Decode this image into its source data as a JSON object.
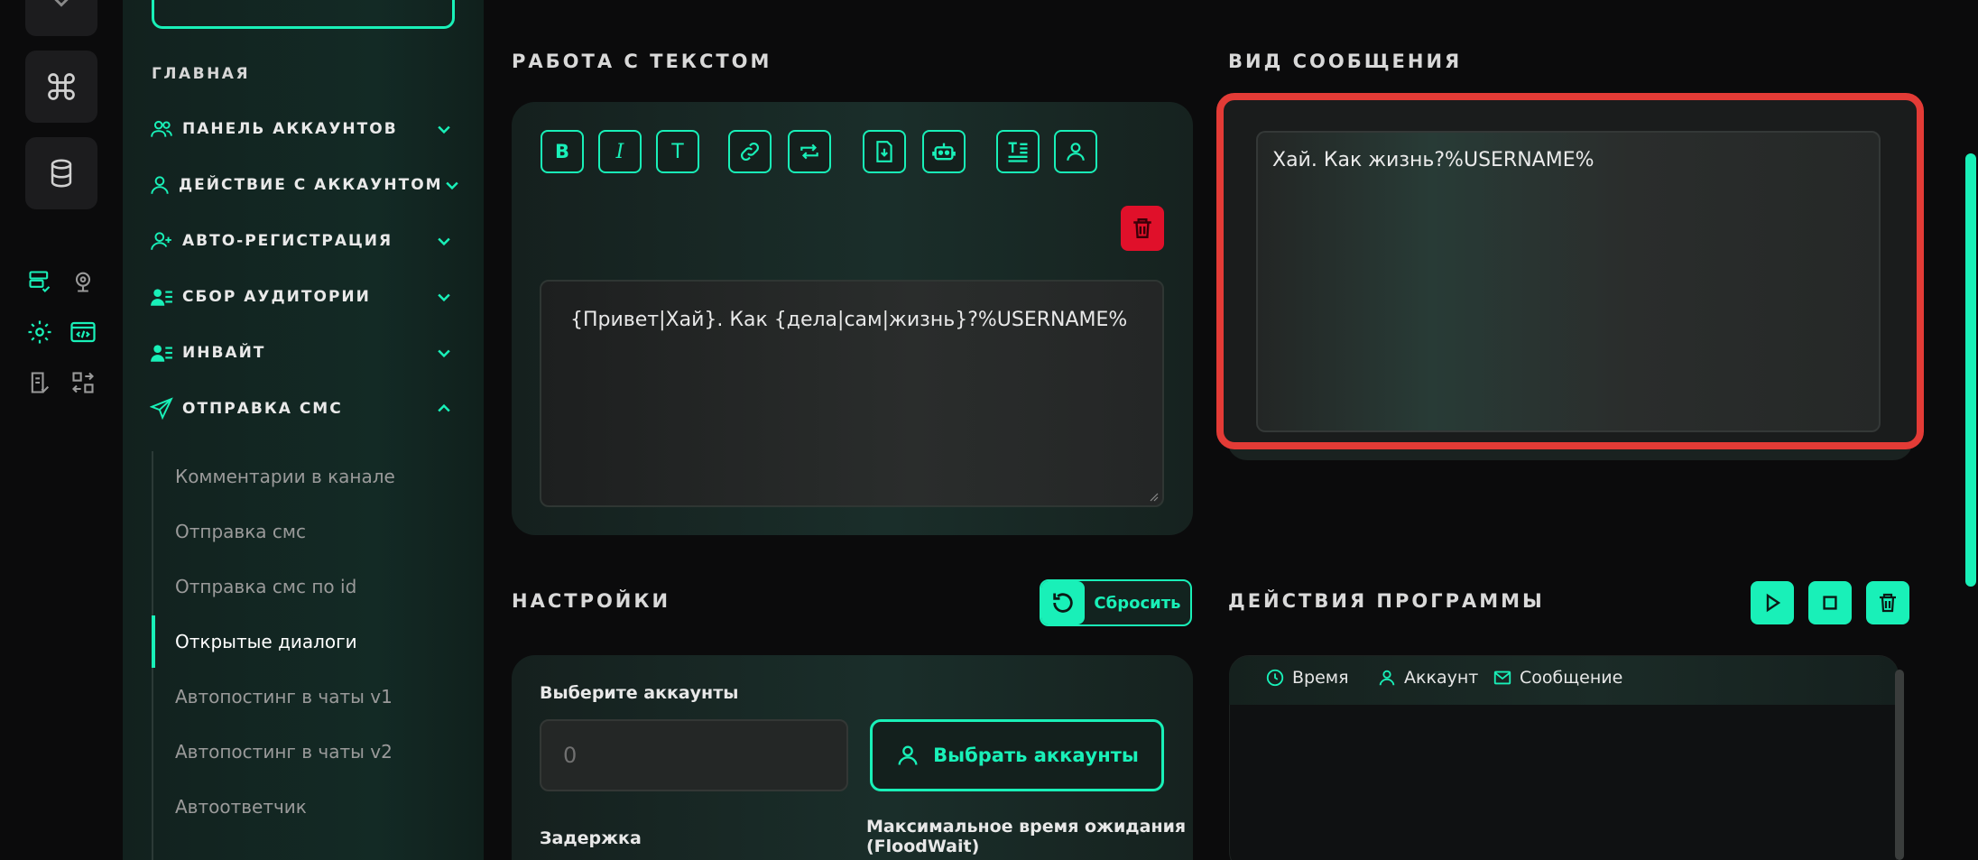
{
  "sidebar": {
    "section_title": "ГЛАВНАЯ",
    "items": [
      {
        "label": "ПАНЕЛЬ АККАУНТОВ",
        "icon": "users-icon"
      },
      {
        "label": "ДЕЙСТВИЕ С АККАУНТОМ",
        "icon": "user-icon"
      },
      {
        "label": "АВТО-РЕГИСТРАЦИЯ",
        "icon": "user-plus-icon"
      },
      {
        "label": "СБОР АУДИТОРИИ",
        "icon": "user-list-icon"
      },
      {
        "label": "ИНВАЙТ",
        "icon": "user-list-icon"
      },
      {
        "label": "ОТПРАВКА СМС",
        "icon": "send-icon"
      }
    ],
    "subitems": [
      "Комментарии в канале",
      "Отправка смс",
      "Отправка смс по id",
      "Открытые диалоги",
      "Автопостинг в чаты v1",
      "Автопостинг в чаты v2",
      "Автоответчик"
    ],
    "active_subitem": "Открытые диалоги"
  },
  "text_work": {
    "title": "РАБОТА С ТЕКСТОМ",
    "toolbar_labels": {
      "bold": "B",
      "italic": "I",
      "text": "T"
    },
    "template": "{Привет|Хай}. Как {дела|сам|жизнь}?%USERNAME%"
  },
  "preview": {
    "title": "ВИД СООБЩЕНИЯ",
    "text": "Хай. Как жизнь?%USERNAME%"
  },
  "settings": {
    "title": "НАСТРОЙКИ",
    "reset_label": "Сбросить",
    "select_accounts_label": "Выберите аккаунты",
    "accounts_placeholder": "0",
    "select_accounts_button": "Выбрать аккаунты",
    "delay_label": "Задержка",
    "floodwait_label_line1": "Максимальное время ожидания",
    "floodwait_label_line2": "(FloodWait)"
  },
  "program_actions": {
    "title": "ДЕЙСТВИЯ ПРОГРАММЫ",
    "columns": [
      "Время",
      "Аккаунт",
      "Сообщение"
    ]
  },
  "colors": {
    "accent": "#19f0b8",
    "danger": "#e0102a",
    "highlight": "#e33b36",
    "background": "#0b0b0c"
  }
}
